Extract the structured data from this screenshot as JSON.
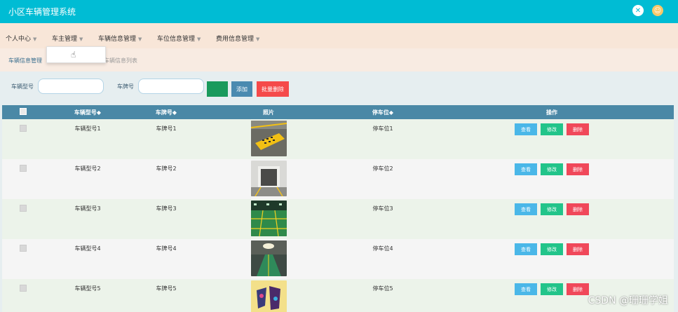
{
  "header": {
    "app_title": "小区车辆管理系统",
    "accent_color": "#00bcd4",
    "icons": [
      "expand-icon",
      "user-avatar-icon"
    ]
  },
  "menu": {
    "items": [
      {
        "label": "个人中心"
      },
      {
        "label": "车主管理"
      },
      {
        "label": "车辆信息管理"
      },
      {
        "label": "车位信息管理"
      },
      {
        "label": "费用信息管理"
      }
    ]
  },
  "breadcrumb": {
    "first": "车辆信息管理",
    "second": "车辆信息列表"
  },
  "search": {
    "model_label": "车辆型号",
    "model_value": "",
    "plate_label": "车牌号",
    "plate_value": "",
    "search_button": "",
    "add_button": "添加",
    "batch_delete_button": "批量删除"
  },
  "table": {
    "columns": [
      "车辆型号◆",
      "车牌号◆",
      "照片",
      "停车位◆",
      "操作"
    ],
    "rows": [
      {
        "model": "车辆型号1",
        "plate": "车牌号1",
        "spot": "停车位1",
        "photo": "photo-yellow-parking-sign"
      },
      {
        "model": "车辆型号2",
        "plate": "车牌号2",
        "spot": "停车位2",
        "photo": "photo-garage-entrance"
      },
      {
        "model": "车辆型号3",
        "plate": "车牌号3",
        "spot": "停车位3",
        "photo": "photo-green-parking-lot"
      },
      {
        "model": "车辆型号4",
        "plate": "车牌号4",
        "spot": "停车位4",
        "photo": "photo-underground-lane"
      },
      {
        "model": "车辆型号5",
        "plate": "车牌号5",
        "spot": "停车位5",
        "photo": "photo-parking-poster"
      }
    ],
    "actions": {
      "view": "查看",
      "edit": "修改",
      "delete": "删除"
    }
  },
  "watermark": "CSDN @珊珊学姐"
}
